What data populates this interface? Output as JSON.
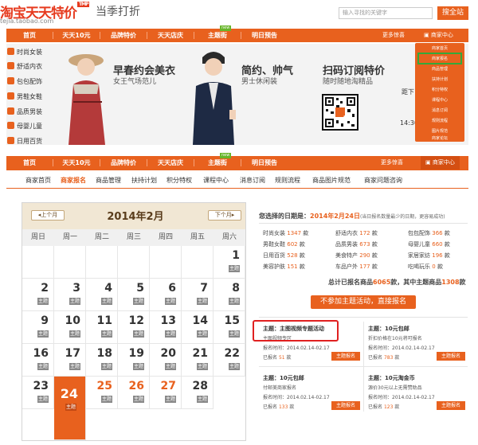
{
  "header": {
    "logo": "淘宝天天特价",
    "logo_badge": "TMP",
    "logo_sub": "tejia.taobao.com",
    "tagline": "当季打折",
    "search_placeholder": "输入寻找的关键字",
    "search_btn": "搜全站"
  },
  "nav1": {
    "items": [
      "首页",
      "天天10元",
      "品牌特价",
      "天天店庆",
      "主题街",
      "明日预告"
    ],
    "hot": "new",
    "more": "更多惊喜",
    "merchant": "商家中心"
  },
  "sidebar": [
    "时尚女装",
    "舒适内衣",
    "包包配饰",
    "男鞋女鞋",
    "品质男装",
    "母婴儿童",
    "日用百货"
  ],
  "banner": {
    "p1_title": "早春约会美衣",
    "p1_sub": "女王气场范儿",
    "p2_title": "简约、帅气",
    "p2_sub": "男士休闲装",
    "p3_title": "扫码订阅特价",
    "p3_sub": "随时随地淘精品",
    "p3_mid": "特",
    "p4_a": "距下",
    "p4_b": "14:30"
  },
  "dropdown": [
    "商家首页",
    "商家报名",
    "商品管理",
    "扶持计划",
    "积分特权",
    "课程中心",
    "消息订阅",
    "规则流程",
    "图片规范",
    "商家论坛"
  ],
  "nav2": {
    "items": [
      "首页",
      "天天10元",
      "品牌特价",
      "天天店庆",
      "主题街",
      "明日预告"
    ],
    "hot": "new",
    "more": "更多惊喜",
    "merchant": "商家中心"
  },
  "subnav": [
    "商家首页",
    "商家报名",
    "商品管理",
    "扶持计划",
    "积分特权",
    "课程中心",
    "消息订阅",
    "规则流程",
    "商品图片规范",
    "商家问题咨询"
  ],
  "calendar": {
    "title": "2014年2月",
    "prev": "上个月",
    "next": "下个月",
    "weekdays": [
      "周日",
      "周一",
      "周二",
      "周三",
      "周四",
      "周五",
      "周六"
    ],
    "days": [
      {
        "d": "1",
        "t": "主题"
      },
      {
        "d": "2",
        "t": "主题"
      },
      {
        "d": "3",
        "t": "主题"
      },
      {
        "d": "4",
        "t": "主题"
      },
      {
        "d": "5",
        "t": "主题"
      },
      {
        "d": "6",
        "t": "主题"
      },
      {
        "d": "7",
        "t": "主题"
      },
      {
        "d": "8",
        "t": "主题"
      },
      {
        "d": "9",
        "t": "主题"
      },
      {
        "d": "10",
        "t": "主题"
      },
      {
        "d": "11",
        "t": "主题"
      },
      {
        "d": "12",
        "t": "主题"
      },
      {
        "d": "13",
        "t": "主题"
      },
      {
        "d": "14",
        "t": "主题"
      },
      {
        "d": "15",
        "t": "主题"
      },
      {
        "d": "16",
        "t": "主题"
      },
      {
        "d": "17",
        "t": "主题"
      },
      {
        "d": "18",
        "t": "主题"
      },
      {
        "d": "19",
        "t": "主题"
      },
      {
        "d": "20",
        "t": "主题"
      },
      {
        "d": "21",
        "t": "主题"
      },
      {
        "d": "22",
        "t": "主题"
      },
      {
        "d": "23",
        "t": "主题"
      },
      {
        "d": "24",
        "t": "主题"
      },
      {
        "d": "25",
        "t": "主题"
      },
      {
        "d": "26",
        "t": "主题"
      },
      {
        "d": "27",
        "t": "主题"
      },
      {
        "d": "28",
        "t": "主题"
      }
    ]
  },
  "right": {
    "date_label": "您选择的日期是：",
    "date_value": "2014年2月24日",
    "date_note": "(当日报名数量最少的日期，更容易成功)",
    "stats": [
      {
        "n": "时尚女装",
        "c": "1347"
      },
      {
        "n": "舒适内衣",
        "c": "172"
      },
      {
        "n": "包包配饰",
        "c": "366"
      },
      {
        "n": "男鞋女鞋",
        "c": "602"
      },
      {
        "n": "品质男装",
        "c": "673"
      },
      {
        "n": "母婴儿童",
        "c": "660"
      },
      {
        "n": "日用百货",
        "c": "528"
      },
      {
        "n": "美食特产",
        "c": "290"
      },
      {
        "n": "家居家纺",
        "c": "196"
      },
      {
        "n": "美容护肤",
        "c": "151"
      },
      {
        "n": "车品户外",
        "c": "177"
      },
      {
        "n": "吃喝玩乐",
        "c": "0"
      }
    ],
    "stat_unit": "款",
    "total_a": "总计已报名商品",
    "total_v": "6065",
    "total_b": "款，其中主题商品",
    "total_t": "1308",
    "total_c": "款",
    "big_btn": "不参加主题活动，直接报名",
    "cards": [
      {
        "title": "主题：主图视频专题活动",
        "sub": "主图视频专区",
        "period": "报名时间：2014.02.14-02.17",
        "signed": "已报名",
        "count": "51",
        "unit": "款",
        "btn": "主题报名"
      },
      {
        "title": "主题：10元包邮",
        "sub": "折扣价格在10元将可报名",
        "period": "报名时间：2014.02.14-02.17",
        "signed": "已报名",
        "count": "783",
        "unit": "款",
        "btn": "主题报名"
      },
      {
        "title": "主题：10元包邮",
        "sub": "付邮美商家报名",
        "period": "报名时间：2014.02.14-02.17",
        "signed": "已报名",
        "count": "133",
        "unit": "款",
        "btn": "主题报名"
      },
      {
        "title": "主题：10元淘金币",
        "sub": "源价30元以上无需赞助品",
        "period": "报名时间：2014.02.14-02.17",
        "signed": "已报名",
        "count": "123",
        "unit": "款",
        "btn": "主题报名"
      }
    ]
  }
}
